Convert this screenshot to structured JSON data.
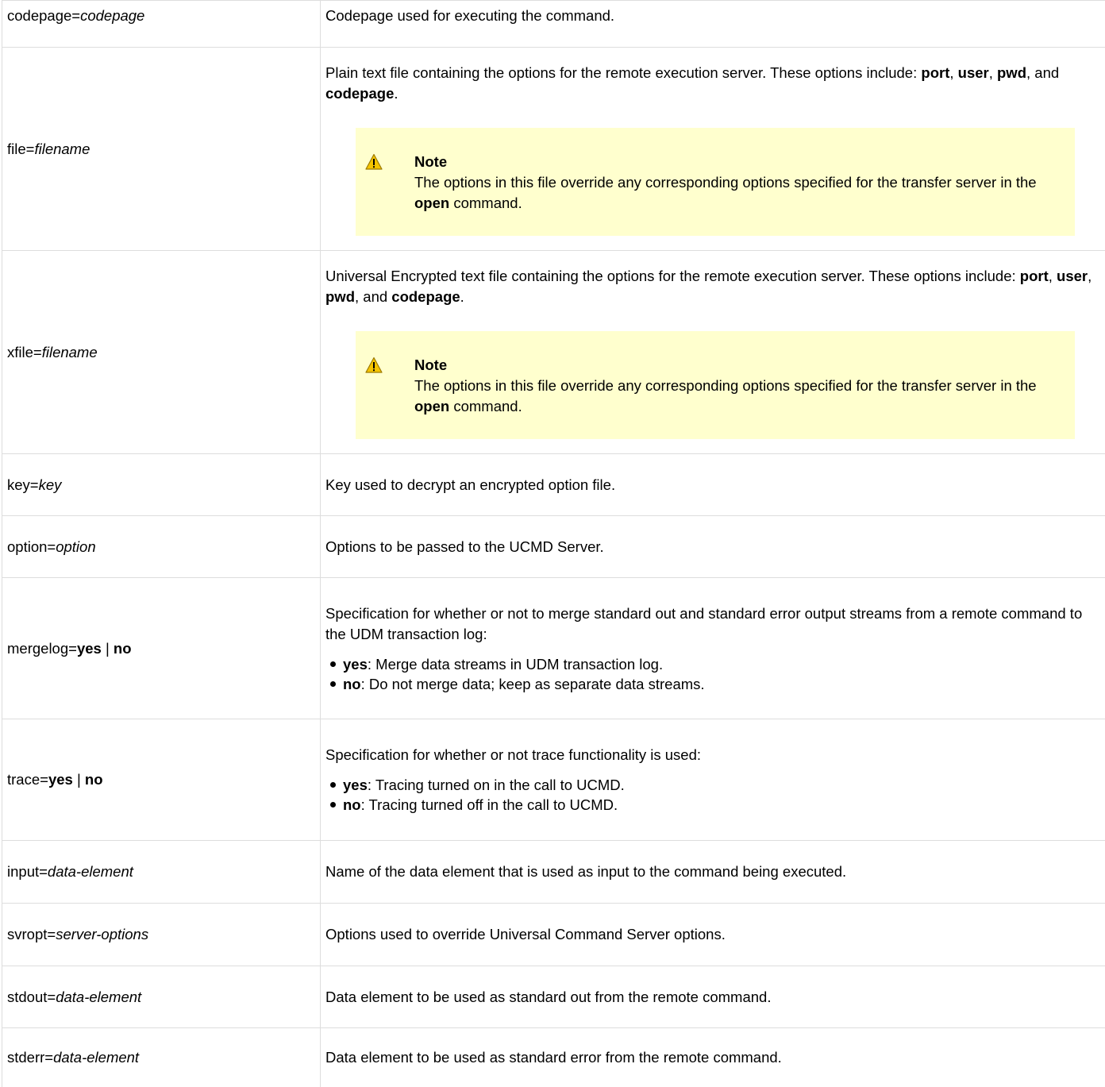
{
  "rows": [
    {
      "name": {
        "pre": "codepage=",
        "italic": "codepage"
      },
      "desc": "Codepage used for executing the command."
    },
    {
      "name": {
        "pre": "file=",
        "italic": "filename"
      },
      "desc": {
        "lead": "Plain text file containing the options for the remote execution server. These options include: ",
        "o1": "port",
        "s1": ", ",
        "o2": "user",
        "s2": ", ",
        "o3": "pwd",
        "s3": ", and ",
        "o4": "codepage",
        "s4": ".",
        "note": {
          "title": "Note",
          "text_a": "The options in this file override any corresponding options specified for the transfer server in the ",
          "bold": "open",
          "text_b": " command."
        }
      }
    },
    {
      "name": {
        "pre": "xfile=",
        "italic": "filename"
      },
      "desc": {
        "lead": "Universal Encrypted text file containing the options for the remote execution server. These options include: ",
        "o1": "port",
        "s1": ", ",
        "o2": "user",
        "s2": ", ",
        "o3": "pwd",
        "s3": ", and ",
        "o4": "codepage",
        "s4": ".",
        "note": {
          "title": "Note",
          "text_a": "The options in this file override any corresponding options specified for the transfer server in the ",
          "bold": "open",
          "text_b": " command."
        }
      }
    },
    {
      "name": {
        "pre": "key=",
        "italic": "key"
      },
      "desc": "Key used to decrypt an encrypted option file."
    },
    {
      "name": {
        "pre": "option=",
        "italic": "option"
      },
      "desc": "Options to be passed to the UCMD Server."
    },
    {
      "name": {
        "pre": "mergelog=",
        "yes": "yes",
        "sep": " | ",
        "no": "no"
      },
      "desc": {
        "lead": "Specification for whether or not to merge standard out and standard error output streams from a remote command to the UDM transaction log:",
        "bullets": [
          {
            "key": "yes",
            "text": ": Merge data streams in UDM transaction log."
          },
          {
            "key": "no",
            "text": ": Do not merge data; keep as separate data streams."
          }
        ]
      }
    },
    {
      "name": {
        "pre": "trace=",
        "yes": "yes",
        "sep": " | ",
        "no": "no"
      },
      "desc": {
        "lead": "Specification for whether or not trace functionality is used:",
        "bullets": [
          {
            "key": "yes",
            "text": ": Tracing turned on in the call to UCMD."
          },
          {
            "key": "no",
            "text": ": Tracing turned off in the call to UCMD."
          }
        ]
      }
    },
    {
      "name": {
        "pre": "input=",
        "italic": "data-element"
      },
      "desc": "Name of the data element that is used as input to the command being executed."
    },
    {
      "name": {
        "pre": "svropt=",
        "italic": "server-options"
      },
      "desc": "Options used to override Universal Command Server options."
    },
    {
      "name": {
        "pre": "stdout=",
        "italic": "data-element"
      },
      "desc": "Data element to be used as standard out from the remote command."
    },
    {
      "name": {
        "pre": "stderr=",
        "italic": "data-element"
      },
      "desc": "Data element to be used as standard error from the remote command."
    }
  ],
  "icons": {
    "note": "warning-triangle-icon"
  },
  "colors": {
    "note_bg": "#ffffce",
    "border": "#dddddd",
    "warning": "#f5c400"
  }
}
